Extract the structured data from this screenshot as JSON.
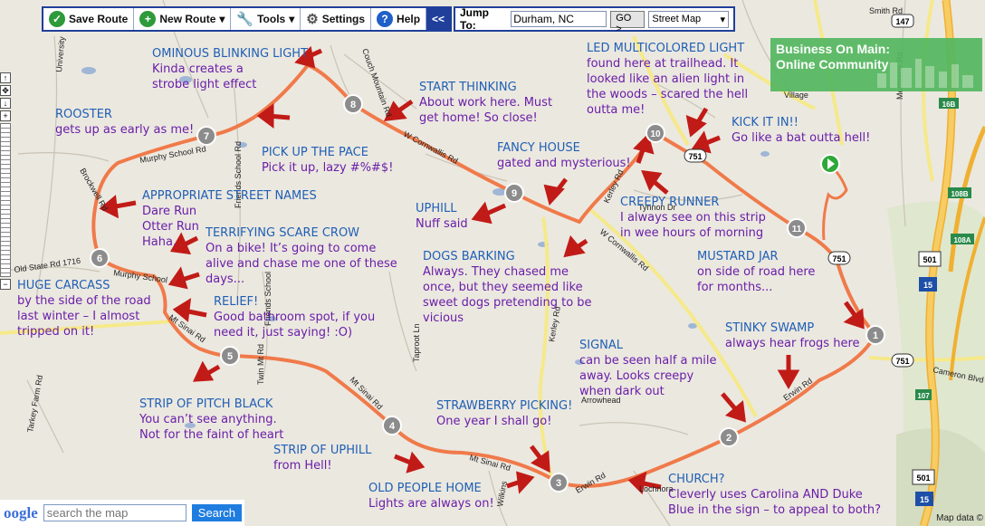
{
  "toolbar": {
    "save_route": "Save Route",
    "new_route": "New Route",
    "tools": "Tools",
    "settings": "Settings",
    "help": "Help",
    "collapse": "<<"
  },
  "jump": {
    "label": "Jump To:",
    "value": "Durham, NC",
    "go": "GO >",
    "map_type": "Street Map"
  },
  "ad": {
    "line1": "Business On Main:",
    "line2": "Online Community"
  },
  "search": {
    "logo": "oogle",
    "placeholder": "search the map",
    "button": "Search"
  },
  "credit": "Map data ©",
  "markers": [
    "1",
    "2",
    "3",
    "4",
    "5",
    "6",
    "7",
    "8",
    "9",
    "10",
    "11"
  ],
  "route_shields": [
    "751",
    "751",
    "751",
    "501",
    "15",
    "501",
    "15",
    "147",
    "107",
    "108A",
    "108B",
    "16B"
  ],
  "roads": [
    "Murphy School Rd",
    "Murphy School",
    "W Cornwallis Rd",
    "W Cornwallis Rd",
    "Mt Sinai Rd",
    "Mt Sinai Rd",
    "Mt Sinai Rd",
    "Erwin Rd",
    "Erwin Rd",
    "Kerley Rd",
    "Kerley Rd",
    "Brockwell Rd",
    "Friends School Rd",
    "Couch Mountain Rd",
    "Cameron Blvd",
    "Morreene Rd",
    "Tynnon Dr",
    "Arrowhead",
    "Lochnora",
    "Village",
    "Wilkins",
    "Taproot Ln",
    "Twin Mt Rd",
    "Tarkey Farm Rd",
    "University",
    "Old State Rd 1716",
    "Friends School",
    "Smith Rd"
  ],
  "annotations": {
    "ominous": {
      "title": "OMINOUS BLINKING LIGHT",
      "lines": [
        "Kinda creates a",
        "strobe light effect"
      ]
    },
    "rooster": {
      "title": "ROOSTER",
      "lines": [
        "gets up as early as me!"
      ]
    },
    "pickup": {
      "title": "PICK UP THE PACE",
      "lines": [
        "Pick it up, lazy #%#$!"
      ]
    },
    "start": {
      "title": "START THINKING",
      "lines": [
        "About work here.  Must",
        "get home! So close!"
      ]
    },
    "led": {
      "title": "LED MULTICOLORED LIGHT",
      "lines": [
        "found here at trailhead.  It",
        "looked like an alien light in",
        "the woods – scared the hell",
        "outta me!"
      ]
    },
    "kick": {
      "title": "KICK IT IN!!",
      "lines": [
        "Go like a bat outta hell!"
      ]
    },
    "fancy": {
      "title": "FANCY HOUSE",
      "lines": [
        "gated and mysterious!"
      ]
    },
    "streets": {
      "title": "APPROPRIATE STREET NAMES",
      "lines": [
        "Dare Run",
        "Otter Run",
        "Haha."
      ]
    },
    "uphill": {
      "title": "UPHILL",
      "lines": [
        "Nuff said"
      ]
    },
    "creepy": {
      "title": "CREEPY RUNNER",
      "lines": [
        "I always see on this strip",
        "in wee hours of morning"
      ]
    },
    "scarecrow": {
      "title": "TERRIFYING SCARE CROW",
      "lines": [
        "On a bike! It’s going to come",
        "alive and chase me one of these",
        "days..."
      ]
    },
    "dogs": {
      "title": "DOGS BARKING",
      "lines": [
        "Always.  They chased me",
        "once, but they seemed like",
        "sweet dogs pretending to be",
        "vicious"
      ]
    },
    "mustard": {
      "title": "MUSTARD JAR",
      "lines": [
        "on side of road here",
        "for months..."
      ]
    },
    "carcass": {
      "title": "HUGE CARCASS",
      "lines": [
        "by the side of the road",
        "last winter – I almost",
        "tripped on it!"
      ]
    },
    "relief": {
      "title": "RELIEF!",
      "lines": [
        "Good bathroom spot, if you",
        "need it, just saying! :O)"
      ]
    },
    "swamp": {
      "title": "STINKY SWAMP",
      "lines": [
        "always hear frogs here"
      ]
    },
    "signal": {
      "title": "SIGNAL",
      "lines": [
        "can be seen half a mile",
        "away.  Looks creepy",
        "when dark out"
      ]
    },
    "pitch": {
      "title": "STRIP OF PITCH BLACK",
      "lines": [
        "You can’t see anything.",
        "Not for the faint of heart"
      ]
    },
    "strawberry": {
      "title": "STRAWBERRY PICKING!",
      "lines": [
        "One year I shall go!"
      ]
    },
    "stripuphill": {
      "title": "STRIP OF UPHILL",
      "lines": [
        "from Hell!"
      ]
    },
    "oldpeople": {
      "title": "OLD PEOPLE HOME",
      "lines": [
        "Lights are always on!"
      ]
    },
    "church": {
      "title": "CHURCH?",
      "lines": [
        "Cleverly uses Carolina AND Duke",
        "Blue in the sign – to appeal to both?"
      ]
    }
  }
}
